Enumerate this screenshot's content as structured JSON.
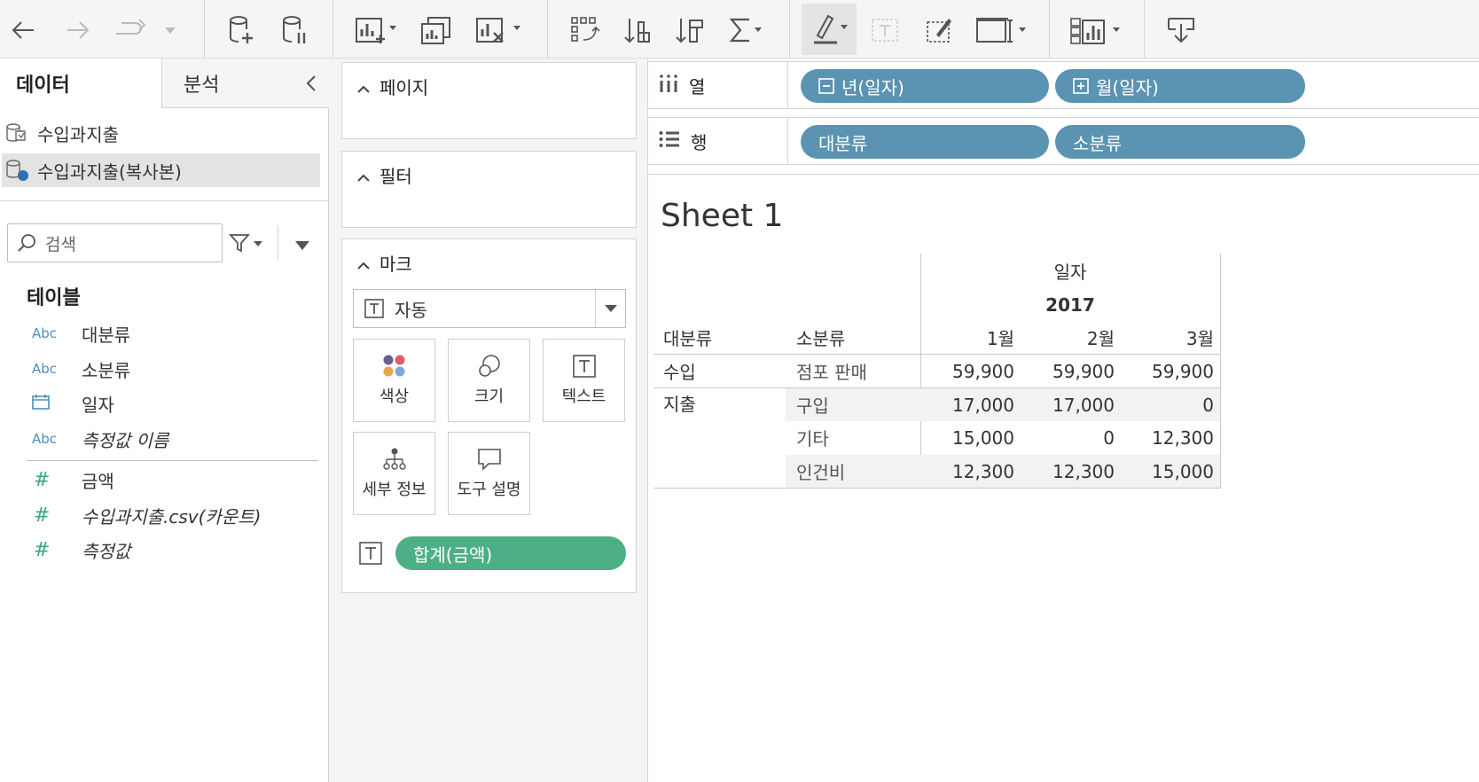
{
  "toolbar": {
    "icons": [
      "back-icon",
      "forward-icon",
      "redo-icon",
      "dropdown-icon",
      "new-data-source-icon",
      "pause-data-icon",
      "new-worksheet-icon",
      "duplicate-icon",
      "clear-icon",
      "swap-icon",
      "sort-asc-icon",
      "sort-desc-icon",
      "totals-icon",
      "highlight-icon",
      "labels-icon",
      "format-icon",
      "fit-icon",
      "show-me-icon",
      "export-icon"
    ]
  },
  "data_pane": {
    "tab_data": "데이터",
    "tab_analysis": "분석",
    "datasources": [
      "수입과지출",
      "수입과지출(복사본)"
    ],
    "search_placeholder": "검색",
    "tables_title": "테이블",
    "dimensions": [
      {
        "type": "Abc",
        "name": "대분류"
      },
      {
        "type": "Abc",
        "name": "소분류"
      },
      {
        "type": "date",
        "name": "일자"
      },
      {
        "type": "Abc",
        "name": "측정값 이름"
      }
    ],
    "measures": [
      {
        "type": "#",
        "name": "금액"
      },
      {
        "type": "#",
        "name": "수입과지출.csv(카운트)"
      },
      {
        "type": "#",
        "name": "측정값"
      }
    ]
  },
  "cards": {
    "pages": "페이지",
    "filters": "필터",
    "marks": "마크",
    "mark_type": "자동",
    "buttons": {
      "color": "색상",
      "size": "크기",
      "text": "텍스트",
      "detail": "세부 정보",
      "tooltip": "도구 설명"
    },
    "text_pill": "합계(금액)"
  },
  "shelves": {
    "columns_label": "열",
    "rows_label": "행",
    "columns": [
      "년(일자)",
      "월(일자)"
    ],
    "rows": [
      "대분류",
      "소분류"
    ]
  },
  "sheet": {
    "title": "Sheet 1",
    "header_top": "일자",
    "year": "2017",
    "col_headers": [
      "대분류",
      "소분류"
    ],
    "months": [
      "1월",
      "2월",
      "3월"
    ],
    "rows": [
      {
        "major": "수입",
        "minor": "점포 판매",
        "values": [
          "59,900",
          "59,900",
          "59,900"
        ]
      },
      {
        "major": "지출",
        "minor": "구입",
        "values": [
          "17,000",
          "17,000",
          "0"
        ]
      },
      {
        "major": "",
        "minor": "기타",
        "values": [
          "15,000",
          "0",
          "12,300"
        ]
      },
      {
        "major": "",
        "minor": "인건비",
        "values": [
          "12,300",
          "12,300",
          "15,000"
        ]
      }
    ]
  }
}
